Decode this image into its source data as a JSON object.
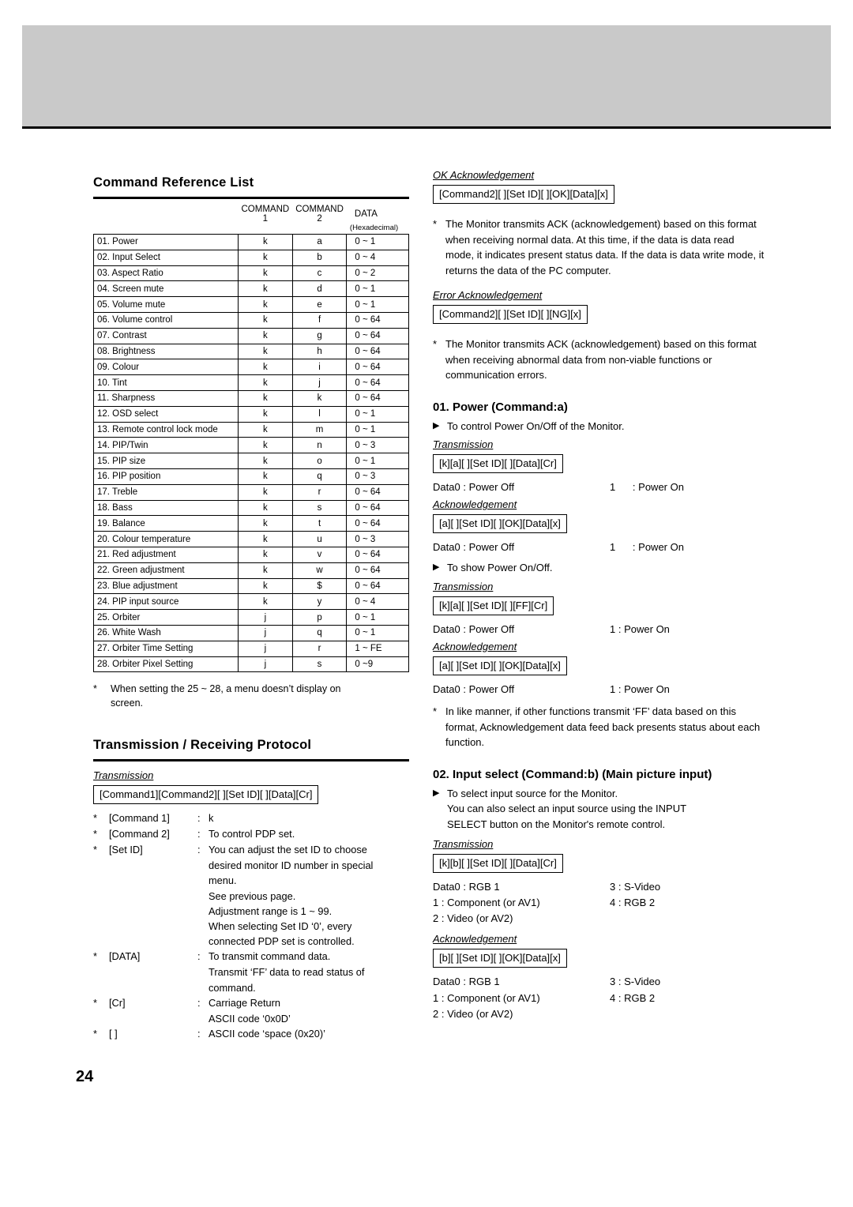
{
  "page_number": "24",
  "left": {
    "section1_title": "Command Reference List",
    "table": {
      "header": {
        "col1": "COMMAND 1",
        "col2": "COMMAND 2",
        "col3": "DATA",
        "col3_sub": "(Hexadecimal)"
      },
      "rows": [
        {
          "name": "01. Power",
          "c1": "k",
          "c2": "a",
          "data": "0 ~ 1"
        },
        {
          "name": "02. Input Select",
          "c1": "k",
          "c2": "b",
          "data": "0 ~ 4"
        },
        {
          "name": "03. Aspect Ratio",
          "c1": "k",
          "c2": "c",
          "data": "0 ~ 2"
        },
        {
          "name": "04. Screen mute",
          "c1": "k",
          "c2": "d",
          "data": "0 ~ 1"
        },
        {
          "name": "05. Volume mute",
          "c1": "k",
          "c2": "e",
          "data": "0 ~ 1"
        },
        {
          "name": "06. Volume control",
          "c1": "k",
          "c2": "f",
          "data": "0 ~ 64"
        },
        {
          "name": "07. Contrast",
          "c1": "k",
          "c2": "g",
          "data": "0 ~ 64"
        },
        {
          "name": "08. Brightness",
          "c1": "k",
          "c2": "h",
          "data": "0 ~ 64"
        },
        {
          "name": "09. Colour",
          "c1": "k",
          "c2": "i",
          "data": "0 ~ 64"
        },
        {
          "name": "10. Tint",
          "c1": "k",
          "c2": "j",
          "data": "0 ~ 64"
        },
        {
          "name": "11. Sharpness",
          "c1": "k",
          "c2": "k",
          "data": "0 ~ 64"
        },
        {
          "name": "12. OSD select",
          "c1": "k",
          "c2": "l",
          "data": "0 ~ 1"
        },
        {
          "name": "13. Remote control lock mode",
          "c1": "k",
          "c2": "m",
          "data": "0 ~ 1"
        },
        {
          "name": "14. PIP/Twin",
          "c1": "k",
          "c2": "n",
          "data": "0 ~ 3"
        },
        {
          "name": "15. PIP size",
          "c1": "k",
          "c2": "o",
          "data": "0 ~ 1"
        },
        {
          "name": "16. PIP position",
          "c1": "k",
          "c2": "q",
          "data": "0 ~ 3"
        },
        {
          "name": "17. Treble",
          "c1": "k",
          "c2": "r",
          "data": "0 ~ 64"
        },
        {
          "name": "18. Bass",
          "c1": "k",
          "c2": "s",
          "data": "0 ~ 64"
        },
        {
          "name": "19. Balance",
          "c1": "k",
          "c2": "t",
          "data": "0 ~ 64"
        },
        {
          "name": "20. Colour temperature",
          "c1": "k",
          "c2": "u",
          "data": "0 ~ 3"
        },
        {
          "name": "21. Red adjustment",
          "c1": "k",
          "c2": "v",
          "data": "0 ~ 64"
        },
        {
          "name": "22. Green adjustment",
          "c1": "k",
          "c2": "w",
          "data": "0 ~ 64"
        },
        {
          "name": "23. Blue adjustment",
          "c1": "k",
          "c2": "$",
          "data": "0 ~ 64"
        },
        {
          "name": "24. PIP input source",
          "c1": "k",
          "c2": "y",
          "data": "0 ~ 4"
        },
        {
          "name": "25. Orbiter",
          "c1": "j",
          "c2": "p",
          "data": "0 ~ 1"
        },
        {
          "name": "26. White Wash",
          "c1": "j",
          "c2": "q",
          "data": "0 ~ 1"
        },
        {
          "name": "27. Orbiter Time Setting",
          "c1": "j",
          "c2": "r",
          "data": "1 ~ FE"
        },
        {
          "name": "28. Orbiter Pixel Setting",
          "c1": "j",
          "c2": "s",
          "data": "0 ~9"
        }
      ]
    },
    "table_note": "When setting the 25 ~ 28, a menu doesn’t display on screen.",
    "section2_title": "Transmission / Receiving  Protocol",
    "transmission_label": "Transmission",
    "transmission_box": "[Command1][Command2][  ][Set ID][  ][Data][Cr]",
    "protocol_items": [
      {
        "key": "[Command 1]",
        "sep": ":",
        "value": "k",
        "cont": []
      },
      {
        "key": "[Command 2]",
        "sep": ":",
        "value": "To control PDP set.",
        "cont": []
      },
      {
        "key": "[Set ID]",
        "sep": ":",
        "value": "You can adjust the set ID to choose",
        "cont": [
          "desired monitor ID number in special",
          "menu.",
          "See previous page.",
          "Adjustment range is 1 ~ 99.",
          "When selecting Set ID ‘0’, every",
          "connected PDP set is controlled."
        ]
      },
      {
        "key": "[DATA]",
        "sep": ":",
        "value": "To transmit command data.",
        "cont": [
          "Transmit ‘FF’ data to read status of",
          "command."
        ]
      },
      {
        "key": "[Cr]",
        "sep": ":",
        "value": "Carriage Return",
        "cont": [
          "ASCII code ‘0x0D’"
        ]
      },
      {
        "key": "[  ]",
        "sep": ":",
        "value": "ASCII code ‘space (0x20)’",
        "cont": []
      }
    ]
  },
  "right": {
    "ok_ack_label": "OK Acknowledgement",
    "ok_ack_box": "[Command2][  ][Set ID][  ][OK][Data][x]",
    "ok_ack_note": "The Monitor transmits ACK (acknowledgement) based on this format when receiving normal data. At this time, if the data is data read mode, it indicates present status data. If the data is data write mode, it returns the data of the PC computer.",
    "err_ack_label": "Error Acknowledgement",
    "err_ack_box": "[Command2][  ][Set ID][  ][NG][x]",
    "err_ack_note": "The Monitor transmits ACK (acknowledgement) based on this format when receiving abnormal data from non-viable functions or communication errors.",
    "s01": {
      "title": "01. Power (Command:a)",
      "bullet1": "To control Power On/Off of the Monitor.",
      "transmission_label": "Transmission",
      "transmission_box": "[k][a][  ][Set ID][  ][Data][Cr]",
      "data1": {
        "label": "Data",
        "off_key": "0",
        "off_sep": ":",
        "off": "Power Off",
        "on_key": "1",
        "on_sep": ":",
        "on": "Power On"
      },
      "ack_label": "Acknowledgement",
      "ack_box": "[a][  ][Set ID][  ][OK][Data][x]",
      "data2": {
        "label": "Data",
        "off_key": "0",
        "off_sep": ":",
        "off": "Power Off",
        "on_key": "1",
        "on_sep": ":",
        "on": "Power On"
      },
      "bullet2": "To show Power On/Off.",
      "transmission2_label": "Transmission",
      "transmission2_box": "[k][a][  ][Set ID][  ][FF][Cr]",
      "data3": {
        "label": "Data",
        "off_key": "0",
        "off_sep": ":",
        "off": "Power Off",
        "on_key": "1",
        "on_sep": ":",
        "on": "Power On"
      },
      "ack2_label": "Acknowledgement",
      "ack2_box": "[a][  ][Set ID][  ][OK][Data][x]",
      "data4": {
        "label": "Data",
        "off_key": "0",
        "off_sep": ":",
        "off": "Power Off",
        "on_key": "1",
        "on_sep": ":",
        "on": "Power On"
      },
      "note": "In like manner, if other functions transmit ‘FF’ data based on this format, Acknowledgement data feed back presents status about each function."
    },
    "s02": {
      "title": "02. Input select (Command:b) (Main picture input)",
      "bullet1_line1": "To select input source for the Monitor.",
      "bullet1_line2": "You can also select an input source using the INPUT",
      "bullet1_line3": "SELECT button on the Monitor's remote control.",
      "transmission_label": "Transmission",
      "transmission_box": "[k][b][  ][Set ID][  ][Data][Cr]",
      "data_label": "Data",
      "options_left": [
        {
          "key": "0",
          "sep": ":",
          "value": "RGB 1"
        },
        {
          "key": "1",
          "sep": ":",
          "value": "Component (or AV1)"
        },
        {
          "key": "2",
          "sep": ":",
          "value": "Video (or AV2)"
        }
      ],
      "options_right": [
        {
          "key": "3",
          "sep": ":",
          "value": "S-Video"
        },
        {
          "key": "4",
          "sep": ":",
          "value": "RGB 2"
        }
      ],
      "ack_label": "Acknowledgement",
      "ack_box": "[b][  ][Set ID][  ][OK][Data][x]",
      "data_label2": "Data",
      "options_left2": [
        {
          "key": "0",
          "sep": ":",
          "value": "RGB 1"
        },
        {
          "key": "1",
          "sep": ":",
          "value": "Component (or AV1)"
        },
        {
          "key": "2",
          "sep": ":",
          "value": "Video (or AV2)"
        }
      ],
      "options_right2": [
        {
          "key": "3",
          "sep": ":",
          "value": "S-Video"
        },
        {
          "key": "4",
          "sep": ":",
          "value": "RGB 2"
        }
      ]
    }
  }
}
